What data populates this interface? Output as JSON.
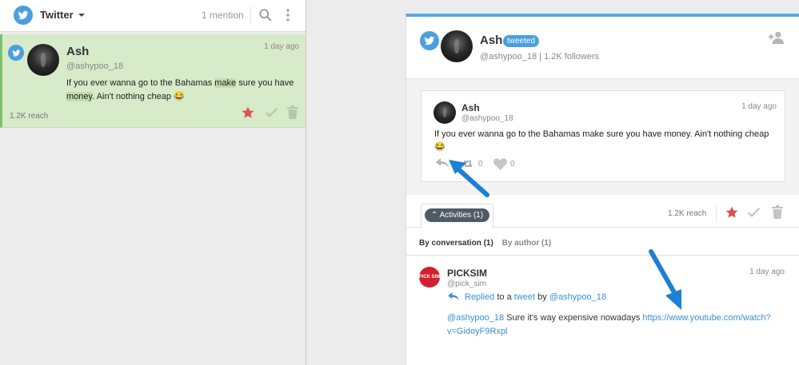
{
  "left_header": {
    "title": "Twitter",
    "mention": "1 mention"
  },
  "left_card": {
    "name": "Ash",
    "handle": "@ashypoo_18",
    "time": "1 day ago",
    "text_parts": [
      "If you ever wanna go to the Bahamas ",
      "make",
      " sure you have ",
      "money",
      ". Ain't nothing cheap 😂"
    ],
    "reach": "1.2K reach"
  },
  "profile": {
    "name": "Ash",
    "badge": "tweeted",
    "handle": "@ashypoo_18",
    "separator": "|",
    "followers": "1.2K followers"
  },
  "tweet": {
    "name": "Ash",
    "handle": "@ashypoo_18",
    "time": "1 day ago",
    "text": "If you ever wanna go to the Bahamas make sure you have money. Ain't nothing cheap 😂",
    "retweets": "0",
    "likes": "0"
  },
  "activities": {
    "tab_label": "Activities (1)",
    "reach": "1.2K reach"
  },
  "conversation_tabs": {
    "by_conversation": "By conversation (1)",
    "by_author": "By author (1)"
  },
  "reply": {
    "avatar_text": "PICK SIM",
    "name": "PICKSIM",
    "handle": "@pick_sim",
    "time": "1 day ago",
    "replied": "Replied",
    "to_a": "to a",
    "tweet_link": "tweet",
    "by": "by",
    "author_link": "@ashypoo_18",
    "mention": "@ashypoo_18",
    "message": " Sure it's way expensive nowadays ",
    "url": "https://www.youtube.com/watch?v=GidoyF9Rxpl"
  },
  "colors": {
    "twitter_blue": "#4a9fe0",
    "card_green": "#d7eac9",
    "star_red": "#d9534f",
    "arrow_blue": "#1e7fd6"
  }
}
